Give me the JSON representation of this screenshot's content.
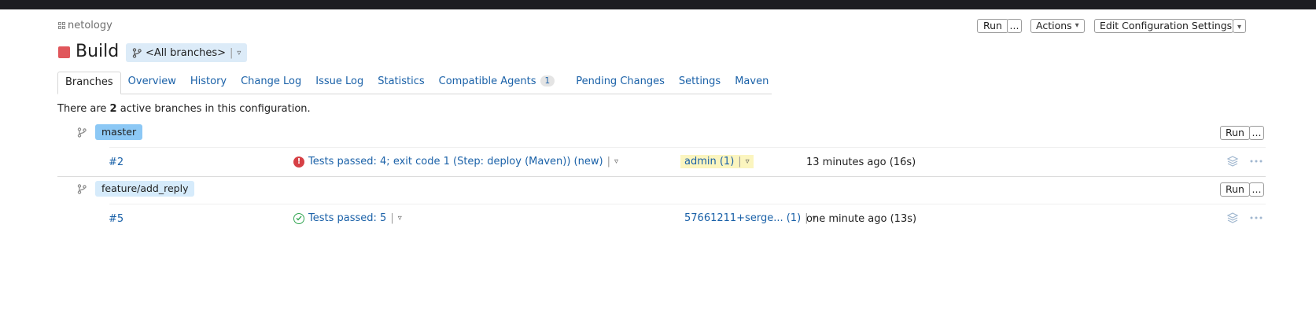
{
  "app": {
    "logo_text": "netology"
  },
  "header": {
    "run_label": "Run",
    "run_more_label": "...",
    "actions_label": "Actions",
    "edit_settings_label": "Edit Configuration Settings",
    "caret": "▾"
  },
  "build": {
    "title": "Build",
    "status_color": "#e0565b",
    "branch_filter": "<All branches>",
    "branch_filter_pipe": "|",
    "branch_filter_caret": "▿"
  },
  "tabs": [
    {
      "label": "Branches",
      "active": true
    },
    {
      "label": "Overview"
    },
    {
      "label": "History"
    },
    {
      "label": "Change Log"
    },
    {
      "label": "Issue Log"
    },
    {
      "label": "Statistics"
    },
    {
      "label": "Compatible Agents",
      "count": "1"
    },
    {
      "label": "Pending Changes"
    },
    {
      "label": "Settings"
    },
    {
      "label": "Maven"
    }
  ],
  "summary": {
    "prefix": "There are",
    "count": "2",
    "suffix": "active branches in this configuration."
  },
  "branches": [
    {
      "name": "master",
      "tag_color": "#8cc8f5",
      "run_label": "Run",
      "more_label": "...",
      "build": {
        "number": "#2",
        "status": "error",
        "status_text": "Tests passed: 4; exit code 1 (Step: deploy (Maven)) (new)",
        "changes": "admin (1)",
        "time": "13 minutes ago (16s)"
      }
    },
    {
      "name": "feature/add_reply",
      "tag_color": "#d6ebfb",
      "run_label": "Run",
      "more_label": "...",
      "build": {
        "number": "#5",
        "status": "success",
        "status_text": "Tests passed: 5",
        "changes": "57661211+serge... (1)",
        "time": "one minute ago (13s)"
      }
    }
  ],
  "common": {
    "pipe": "|",
    "caret": "▿"
  },
  "colors": {
    "link": "#1a61a8",
    "error": "#d64045",
    "success": "#32a551",
    "highlight": "#fbf5bf"
  }
}
